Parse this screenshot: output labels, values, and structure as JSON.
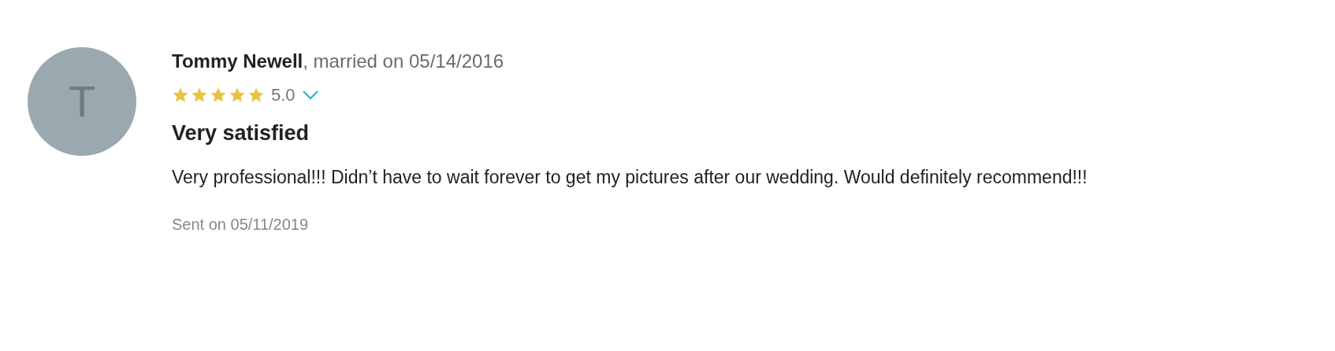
{
  "review": {
    "avatar_initial": "T",
    "byline": "**Tommy Newell**, married on 05/14/2016",
    "stars": 5,
    "rating": "5.0",
    "expanded": false,
    "title": "Very satisfied",
    "body": "Very professional!!! Didn’t have to wait forever to get my pictures after our wedding. Would definitely recommend!!!",
    "sent": "Sent on 05/11/2019"
  }
}
